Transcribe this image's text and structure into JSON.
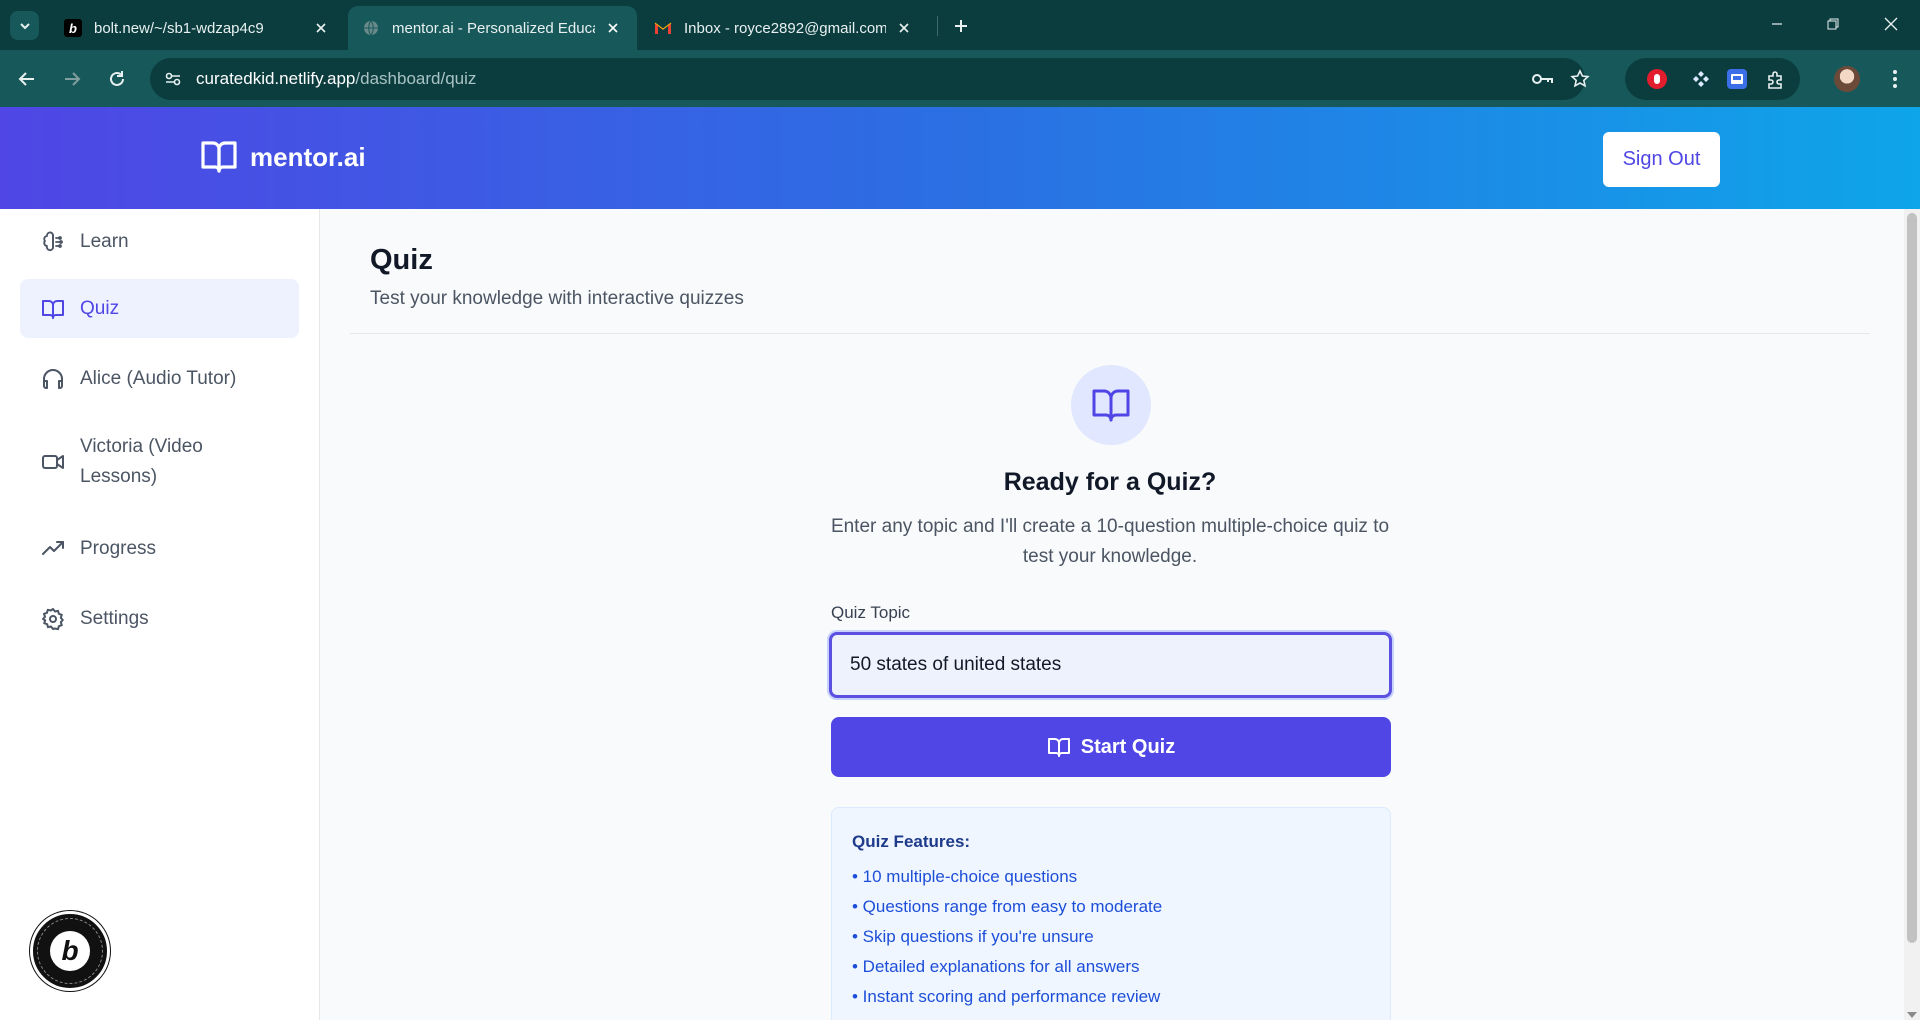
{
  "browser": {
    "tabs": [
      {
        "title": "bolt.new/~/sb1-wdzap4c9",
        "favicon": "bolt-icon"
      },
      {
        "title": "mentor.ai - Personalized Educat",
        "favicon": "globe-icon"
      },
      {
        "title": "Inbox - royce2892@gmail.com",
        "favicon": "gmail-icon"
      }
    ],
    "url_host": "curatedkid.netlify.app",
    "url_path": "/dashboard/quiz"
  },
  "header": {
    "brand": "mentor.ai",
    "signout_label": "Sign Out"
  },
  "sidebar": {
    "items": [
      {
        "label": "Learn",
        "icon": "brain-icon"
      },
      {
        "label": "Quiz",
        "icon": "book-open-icon",
        "active": true
      },
      {
        "label": "Alice (Audio Tutor)",
        "icon": "headphones-icon"
      },
      {
        "label": "Victoria (Video Lessons)",
        "icon": "video-icon"
      },
      {
        "label": "Progress",
        "icon": "trending-up-icon"
      },
      {
        "label": "Settings",
        "icon": "gear-icon"
      }
    ]
  },
  "main": {
    "title": "Quiz",
    "subtitle": "Test your knowledge with interactive quizzes",
    "ready_title": "Ready for a Quiz?",
    "ready_desc": "Enter any topic and I'll create a 10-question multiple-choice quiz to test your knowledge.",
    "topic_label": "Quiz Topic",
    "topic_value": "50 states of united states",
    "start_label": "Start Quiz",
    "features_title": "Quiz Features:",
    "features": [
      "• 10 multiple-choice questions",
      "• Questions range from easy to moderate",
      "• Skip questions if you're unsure",
      "• Detailed explanations for all answers",
      "• Instant scoring and performance review"
    ]
  },
  "colors": {
    "accent": "#4f46e5",
    "header_gradient_start": "#4f46e5",
    "header_gradient_end": "#0ea5e9",
    "chrome": "#0b3d3f"
  }
}
